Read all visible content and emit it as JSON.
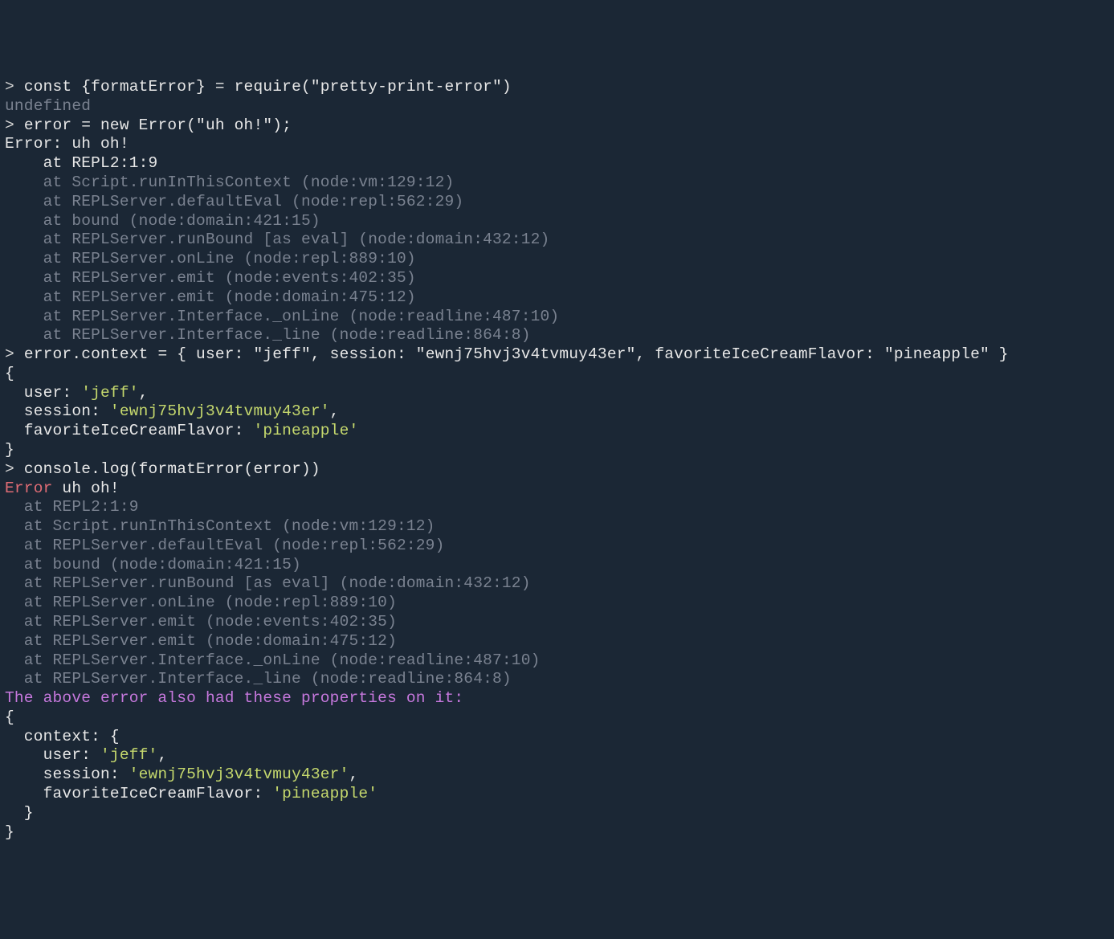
{
  "lines": {
    "l1_prompt": "> ",
    "l1_input": "const {formatError} = require(\"pretty-print-error\")",
    "l2": "undefined",
    "l3_prompt": "> ",
    "l3_input": "error = new Error(\"uh oh!\");",
    "l4": "Error: uh oh!",
    "l5": "    at REPL2:1:9",
    "l6": "    at Script.runInThisContext (node:vm:129:12)",
    "l7": "    at REPLServer.defaultEval (node:repl:562:29)",
    "l8": "    at bound (node:domain:421:15)",
    "l9": "    at REPLServer.runBound [as eval] (node:domain:432:12)",
    "l10": "    at REPLServer.onLine (node:repl:889:10)",
    "l11": "    at REPLServer.emit (node:events:402:35)",
    "l12": "    at REPLServer.emit (node:domain:475:12)",
    "l13": "    at REPLServer.Interface._onLine (node:readline:487:10)",
    "l14": "    at REPLServer.Interface._line (node:readline:864:8)",
    "l15_prompt": "> ",
    "l15_input": "error.context = { user: \"jeff\", session: \"ewnj75hvj3v4tvmuy43er\", favoriteIceCreamFlavor: \"pineapple\" }",
    "l16": "{",
    "l17_key": "  user: ",
    "l17_val": "'jeff'",
    "l17_end": ",",
    "l18_key": "  session: ",
    "l18_val": "'ewnj75hvj3v4tvmuy43er'",
    "l18_end": ",",
    "l19_key": "  favoriteIceCreamFlavor: ",
    "l19_val": "'pineapple'",
    "l20": "}",
    "l21_prompt": "> ",
    "l21_input": "console.log(formatError(error))",
    "l22_err": "Error",
    "l22_msg": " uh oh!",
    "l23": "  at REPL2:1:9",
    "l24": "  at Script.runInThisContext (node:vm:129:12)",
    "l25": "  at REPLServer.defaultEval (node:repl:562:29)",
    "l26": "  at bound (node:domain:421:15)",
    "l27": "  at REPLServer.runBound [as eval] (node:domain:432:12)",
    "l28": "  at REPLServer.onLine (node:repl:889:10)",
    "l29": "  at REPLServer.emit (node:events:402:35)",
    "l30": "  at REPLServer.emit (node:domain:475:12)",
    "l31": "  at REPLServer.Interface._onLine (node:readline:487:10)",
    "l32": "  at REPLServer.Interface._line (node:readline:864:8)",
    "l33": "The above error also had these properties on it:",
    "l34": "{",
    "l35": "  context: {",
    "l36_key": "    user: ",
    "l36_val": "'jeff'",
    "l36_end": ",",
    "l37_key": "    session: ",
    "l37_val": "'ewnj75hvj3v4tvmuy43er'",
    "l37_end": ",",
    "l38_key": "    favoriteIceCreamFlavor: ",
    "l38_val": "'pineapple'",
    "l39": "  }",
    "l40": "}"
  }
}
